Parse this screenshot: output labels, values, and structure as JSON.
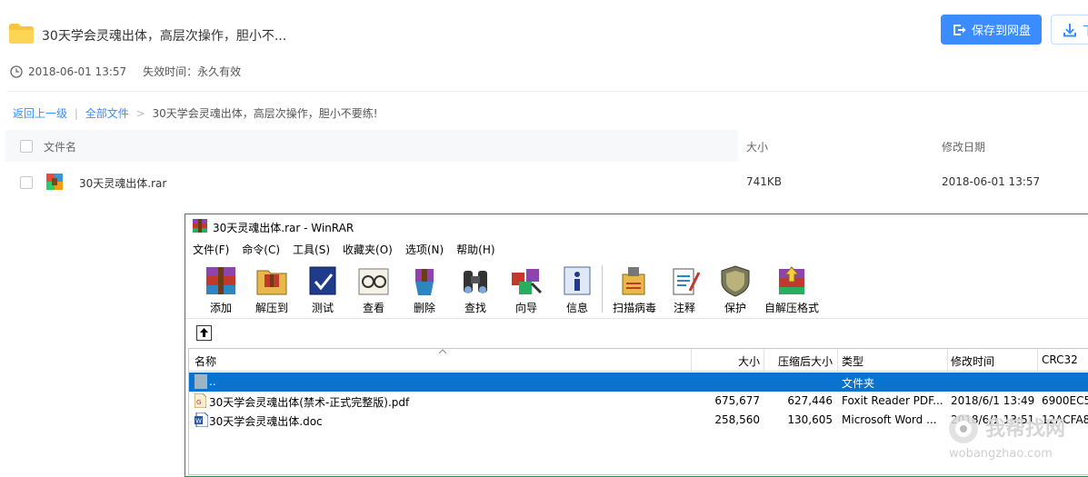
{
  "share": {
    "title": "30天学会灵魂出体，高层次操作，胆小不...",
    "save_button": "保存到网盘",
    "download_button": "下",
    "date": "2018-06-01 13:57",
    "expire_label": "失效时间：永久有效"
  },
  "breadcrumb": {
    "back": "返回上一级",
    "sep": "|",
    "all_files": "全部文件",
    "arrow": ">",
    "current": "30天学会灵魂出体，高层次操作，胆小不要练!"
  },
  "file_list": {
    "headers": {
      "name": "文件名",
      "size": "大小",
      "date": "修改日期"
    },
    "rows": [
      {
        "name": "30天灵魂出体.rar",
        "size": "741KB",
        "date": "2018-06-01 13:57"
      }
    ]
  },
  "winrar": {
    "title": "30天灵魂出体.rar - WinRAR",
    "menu": [
      "文件(F)",
      "命令(C)",
      "工具(S)",
      "收藏夹(O)",
      "选项(N)",
      "帮助(H)"
    ],
    "toolbar": [
      "添加",
      "解压到",
      "测试",
      "查看",
      "删除",
      "查找",
      "向导",
      "信息",
      "扫描病毒",
      "注释",
      "保护",
      "自解压格式"
    ],
    "columns": {
      "name": "名称",
      "size": "大小",
      "packed": "压缩后大小",
      "type": "类型",
      "modified": "修改时间",
      "crc": "CRC32"
    },
    "rows": [
      {
        "name": "..",
        "size": "",
        "packed": "",
        "type": "文件夹",
        "modified": "",
        "crc": ""
      },
      {
        "name": "30天学会灵魂出体(禁术-正式完整版).pdf",
        "size": "675,677",
        "packed": "627,446",
        "type": "Foxit Reader PDF...",
        "modified": "2018/6/1 13:49",
        "crc": "6900EC5"
      },
      {
        "name": "30天学会灵魂出体.doc",
        "size": "258,560",
        "packed": "130,605",
        "type": "Microsoft Word ...",
        "modified": "2018/6/1 13:51",
        "crc": "12ACFA8"
      }
    ]
  },
  "watermark": {
    "line1": "我帮找网",
    "line2": "wobangzhao.com"
  },
  "colors": {
    "accent": "#3b8cff",
    "selection": "#0a73d0",
    "window_border": "#2c8a3a"
  }
}
